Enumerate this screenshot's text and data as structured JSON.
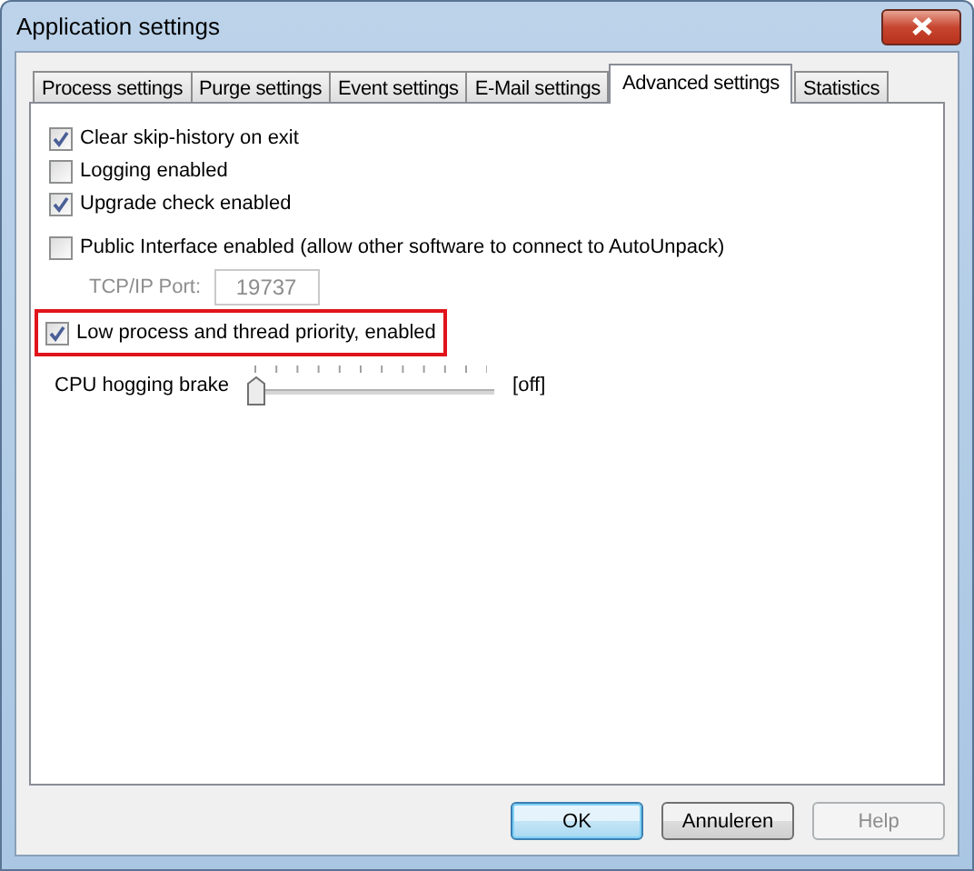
{
  "window": {
    "title": "Application settings"
  },
  "tabs": [
    {
      "label": "Process settings",
      "selected": false
    },
    {
      "label": "Purge settings",
      "selected": false
    },
    {
      "label": "Event settings",
      "selected": false
    },
    {
      "label": "E-Mail settings",
      "selected": false
    },
    {
      "label": "Advanced settings",
      "selected": true
    },
    {
      "label": "Statistics",
      "selected": false
    }
  ],
  "options": [
    {
      "kind": "checkbox",
      "label": "Clear skip-history on exit",
      "checked": true,
      "highlighted": false
    },
    {
      "kind": "checkbox",
      "label": "Logging enabled",
      "checked": false,
      "highlighted": false
    },
    {
      "kind": "checkbox",
      "label": "Upgrade check enabled",
      "checked": true,
      "highlighted": false
    },
    {
      "kind": "checkbox",
      "label": "Public Interface enabled (allow other software to connect to AutoUnpack)",
      "checked": false,
      "highlighted": false
    },
    {
      "kind": "field",
      "label": "TCP/IP Port:",
      "value": "19737",
      "disabled": true
    },
    {
      "kind": "checkbox",
      "label": "Low process and thread priority, enabled",
      "checked": true,
      "highlighted": true
    },
    {
      "kind": "slider",
      "label": "CPU hogging brake",
      "level": 0,
      "reading": "[off]"
    }
  ],
  "buttons": [
    {
      "label": "OK",
      "default": true,
      "disabled": false
    },
    {
      "label": "Annuleren",
      "default": false,
      "disabled": false
    },
    {
      "label": "Help",
      "default": false,
      "disabled": true
    }
  ]
}
